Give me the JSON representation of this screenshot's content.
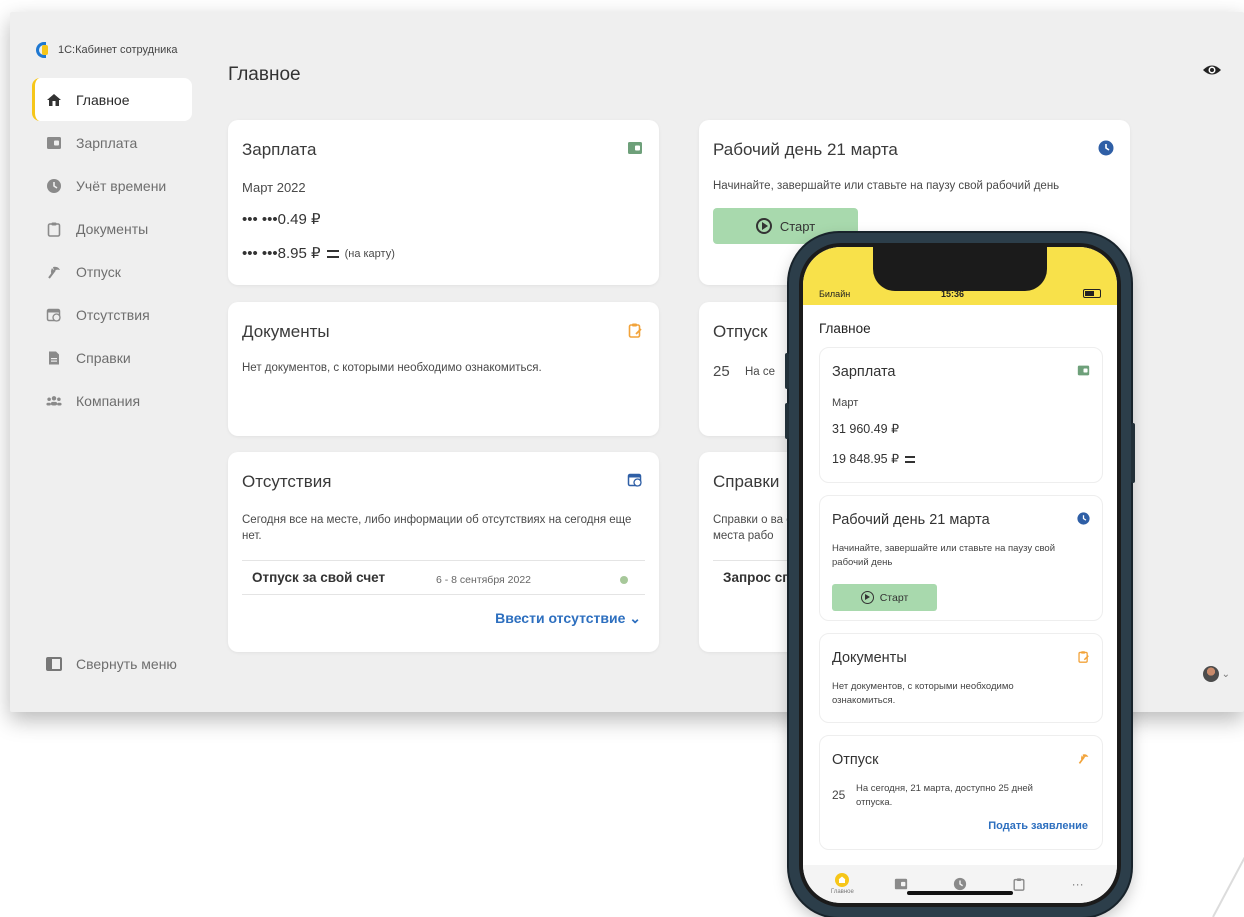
{
  "desktop": {
    "logo_text": "1С:Кабинет сотрудника",
    "page_title": "Главное",
    "sidebar": [
      {
        "label": "Главное",
        "icon": "home-icon"
      },
      {
        "label": "Зарплата",
        "icon": "wallet-icon"
      },
      {
        "label": "Учёт времени",
        "icon": "clock-icon"
      },
      {
        "label": "Документы",
        "icon": "clipboard-icon"
      },
      {
        "label": "Отпуск",
        "icon": "palm-icon"
      },
      {
        "label": "Отсутствия",
        "icon": "calendar-clock-icon"
      },
      {
        "label": "Справки",
        "icon": "document-icon"
      },
      {
        "label": "Компания",
        "icon": "people-icon"
      }
    ],
    "collapse_label": "Свернуть меню",
    "salary": {
      "title": "Зарплата",
      "month": "Март 2022",
      "amount_1": "••• •••0.49 ₽",
      "amount_2": "••• •••8.95 ₽",
      "card_note": "(на карту)"
    },
    "workday": {
      "title": "Рабочий день 21 марта",
      "text": "Начинайте, завершайте или ставьте на паузу свой рабочий день",
      "start": "Старт"
    },
    "documents": {
      "title": "Документы",
      "text": "Нет документов, с которыми необходимо ознакомиться."
    },
    "vacation": {
      "title": "Отпуск",
      "days": "25",
      "text": "На се"
    },
    "absences": {
      "title": "Отсутствия",
      "text": "Сегодня все на месте, либо информации об отсутствиях на сегодня еще нет.",
      "item_name": "Отпуск за свой счет",
      "item_dates": "6 - 8 сентября 2022",
      "action": "Ввести отсутствие ⌄"
    },
    "certificates": {
      "title": "Справки",
      "text": "Справки о ва с места рабо",
      "item": "Запрос сп"
    }
  },
  "mobile": {
    "carrier": "Билайн",
    "time": "15:36",
    "title": "Главное",
    "salary": {
      "title": "Зарплата",
      "month": "Март",
      "amount_1": "31 960.49 ₽",
      "amount_2": "19 848.95 ₽"
    },
    "workday": {
      "title": "Рабочий день 21 марта",
      "text": "Начинайте, завершайте или ставьте на паузу свой рабочий день",
      "start": "Старт"
    },
    "documents": {
      "title": "Документы",
      "text": "Нет документов, с которыми необходимо ознакомиться."
    },
    "vacation": {
      "title": "Отпуск",
      "days": "25",
      "text": "На сегодня, 21 марта, доступно 25 дней отпуска.",
      "action": "Подать заявление"
    },
    "tabbar": {
      "home_label": "Главное",
      "more": "···"
    }
  },
  "colors": {
    "accent_yellow": "#f6c619",
    "start_green": "#a8d9ad",
    "link_blue": "#2d6fbf",
    "icon_green": "#6ea07a",
    "icon_orange": "#f2a33a",
    "icon_blue": "#2f5fa6"
  }
}
